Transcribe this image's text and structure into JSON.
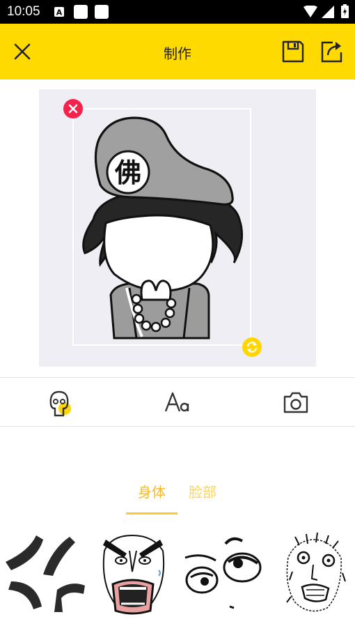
{
  "status_bar": {
    "time": "10:05"
  },
  "app_bar": {
    "title": "制作"
  },
  "tabs": [
    {
      "label": "身体",
      "selected": true
    },
    {
      "label": "脸部",
      "selected": false
    }
  ],
  "colors": {
    "accent_yellow": "#FFDA00",
    "tab_active": "#F5B82E",
    "tab_inactive": "#FFD45C",
    "delete_red": "#F5224B"
  },
  "icons": {
    "close": "close-icon",
    "save": "save-icon",
    "share": "share-icon",
    "sticker_tool": "sticker-face-icon",
    "text_tool": "text-aa-icon",
    "photo_tool": "camera-icon",
    "delete": "delete-x-icon",
    "rotate": "rotate-icon"
  }
}
